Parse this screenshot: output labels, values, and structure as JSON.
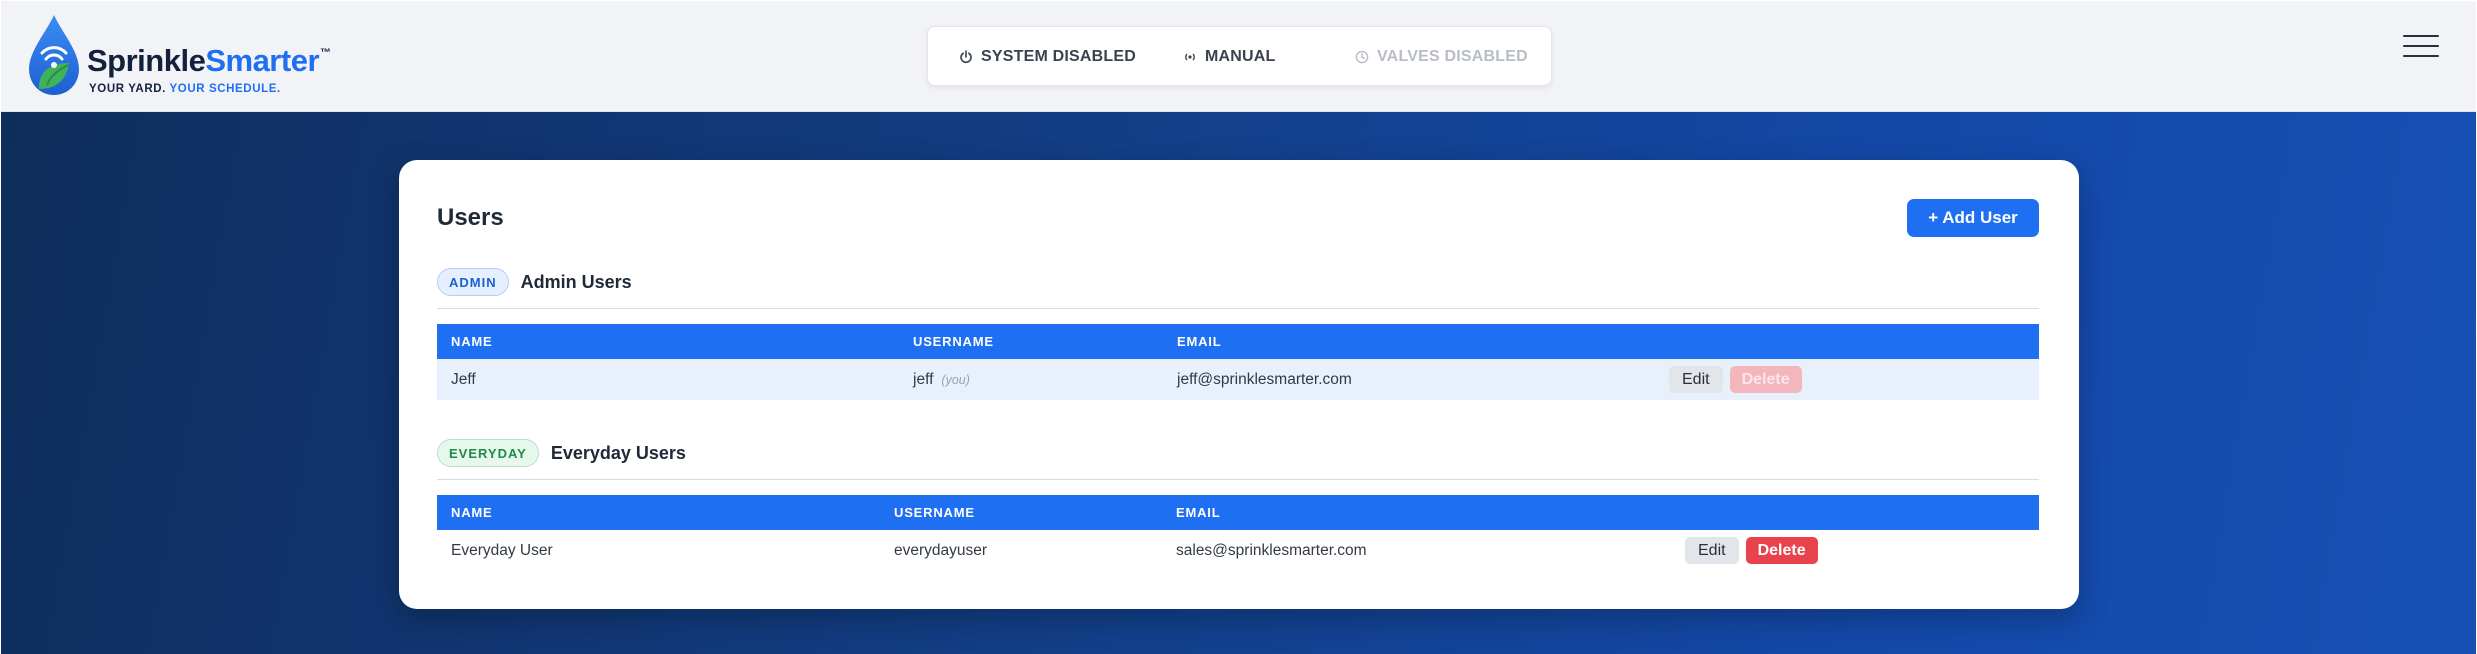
{
  "header": {
    "brand_primary": "Sprinkle",
    "brand_accent": "Smarter",
    "brand_trademark": "™",
    "tagline_primary": "YOUR YARD.",
    "tagline_accent": "YOUR SCHEDULE.",
    "status": [
      {
        "label": "SYSTEM DISABLED",
        "icon": "power-icon",
        "enabled": true
      },
      {
        "label": "MANUAL",
        "icon": "radio-signal-icon",
        "enabled": true
      },
      {
        "label": "VALVES DISABLED",
        "icon": "clock-icon",
        "enabled": false
      }
    ],
    "menu_icon": "hamburger-menu-icon"
  },
  "colors": {
    "accent": "#1e6ff2",
    "brand_dark": "#14213d",
    "delete": "#e8434c",
    "background_gradient_start": "#0f2d5c",
    "background_gradient_end": "#1650b6"
  },
  "users_card": {
    "title": "Users",
    "add_button_label": "+ Add User",
    "admin_section": {
      "badge": "ADMIN",
      "title": "Admin Users",
      "columns": [
        "NAME",
        "USERNAME",
        "EMAIL"
      ],
      "rows": [
        {
          "name": "Jeff",
          "username": "jeff",
          "you_tag": "(you)",
          "email": "jeff@sprinklesmarter.com",
          "edit_label": "Edit",
          "delete_label": "Delete",
          "delete_enabled": false
        }
      ]
    },
    "everyday_section": {
      "badge": "EVERYDAY",
      "title": "Everyday Users",
      "columns": [
        "NAME",
        "USERNAME",
        "EMAIL"
      ],
      "rows": [
        {
          "name": "Everyday User",
          "username": "everydayuser",
          "email": "sales@sprinklesmarter.com",
          "edit_label": "Edit",
          "delete_label": "Delete",
          "delete_enabled": true
        }
      ]
    }
  }
}
